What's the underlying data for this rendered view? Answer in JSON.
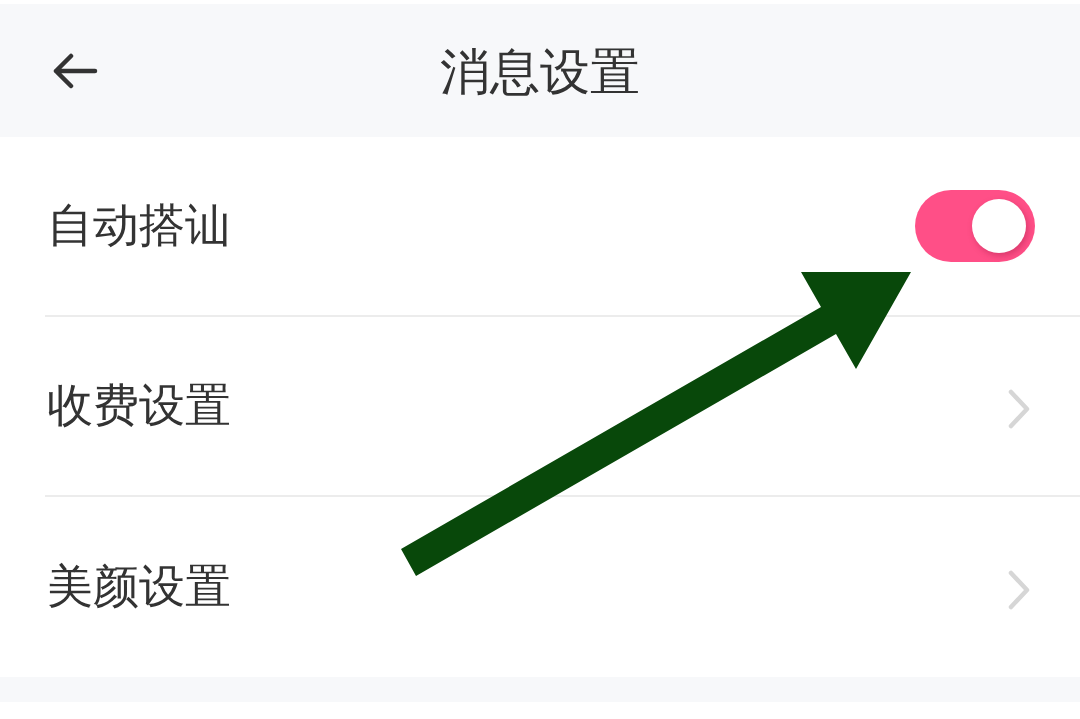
{
  "header": {
    "title": "消息设置"
  },
  "rows": [
    {
      "kind": "toggle",
      "label": "自动搭讪",
      "on": true
    },
    {
      "kind": "link",
      "label": "收费设置"
    },
    {
      "kind": "link",
      "label": "美颜设置"
    }
  ]
}
